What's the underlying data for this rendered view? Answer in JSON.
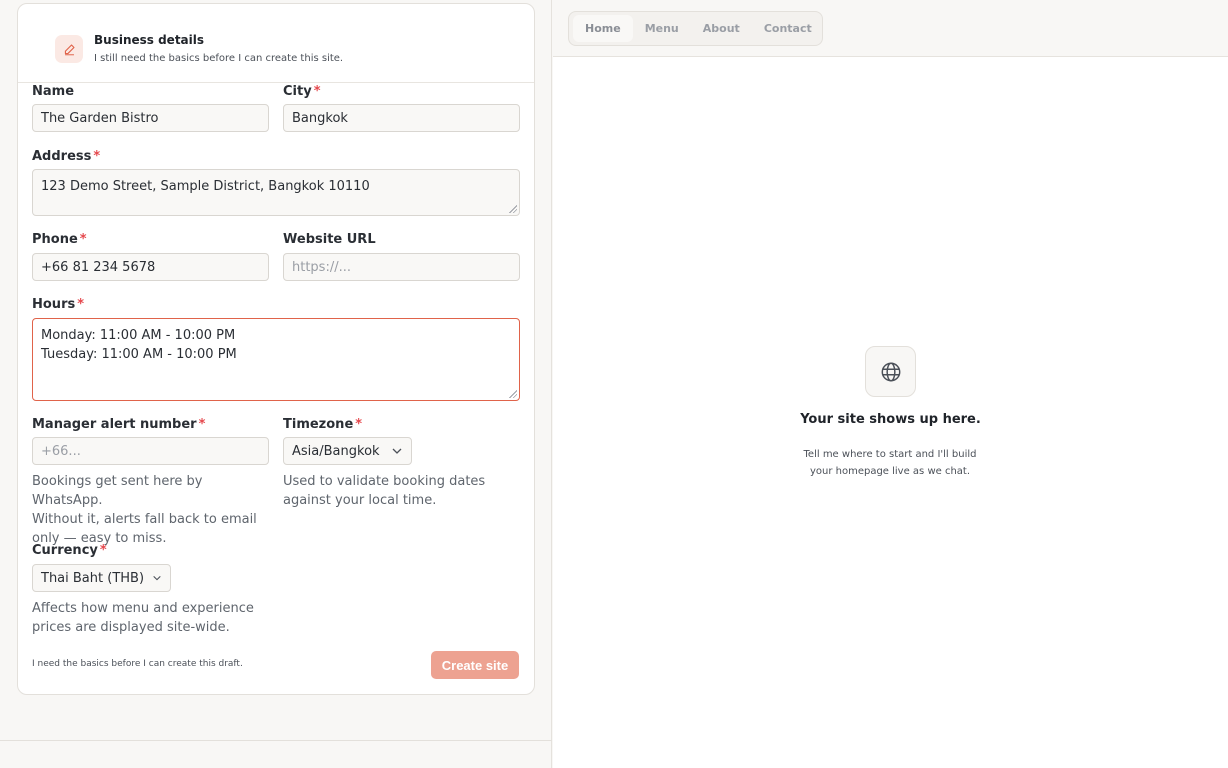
{
  "header": {
    "icon": "edit-icon",
    "title": "Business details",
    "subtitle": "I still need the basics before I can create this site."
  },
  "form": {
    "name": {
      "label": "Name",
      "value": "The Garden Bistro"
    },
    "city": {
      "label": "City",
      "required_mark": "*",
      "value": "Bangkok"
    },
    "address": {
      "label": "Address",
      "required_mark": "*",
      "value": "123 Demo Street, Sample District, Bangkok 10110"
    },
    "phone": {
      "label": "Phone",
      "required_mark": "*",
      "value": "+66 81 234 5678"
    },
    "website": {
      "label": "Website URL",
      "value": "",
      "placeholder": "https://..."
    },
    "hours": {
      "label": "Hours",
      "required_mark": "*",
      "lines": [
        "Monday: 11:00 AM - 10:00 PM",
        "Tuesday: 11:00 AM - 10:00 PM"
      ]
    },
    "manager_alert": {
      "label": "Manager alert number",
      "required_mark": "*",
      "value": "",
      "placeholder": "+66...",
      "help": [
        "Bookings get sent here by WhatsApp.",
        "Without it, alerts fall back to email",
        "only — easy to miss."
      ]
    },
    "timezone": {
      "label": "Timezone",
      "required_mark": "*",
      "value": "Asia/Bangkok",
      "help": [
        "Used to validate booking dates",
        "against your local time."
      ]
    },
    "currency": {
      "label": "Currency",
      "required_mark": "*",
      "value": "Thai Baht (THB)",
      "help": [
        "Affects how menu and experience",
        "prices are displayed site-wide."
      ]
    }
  },
  "footer": {
    "note": "I need the basics before I can create this draft.",
    "create_label": "Create site"
  },
  "preview": {
    "nav": [
      "Home",
      "Menu",
      "About",
      "Contact"
    ],
    "active_nav": "Home",
    "icon": "globe-icon",
    "title": "Your site shows up here.",
    "subtitle_lines": [
      "Tell me where to start and I'll build",
      "your homepage live as we chat."
    ]
  },
  "colors": {
    "accent": "#e0634a",
    "button_disabled": "#eda291",
    "required": "#e5484d"
  }
}
